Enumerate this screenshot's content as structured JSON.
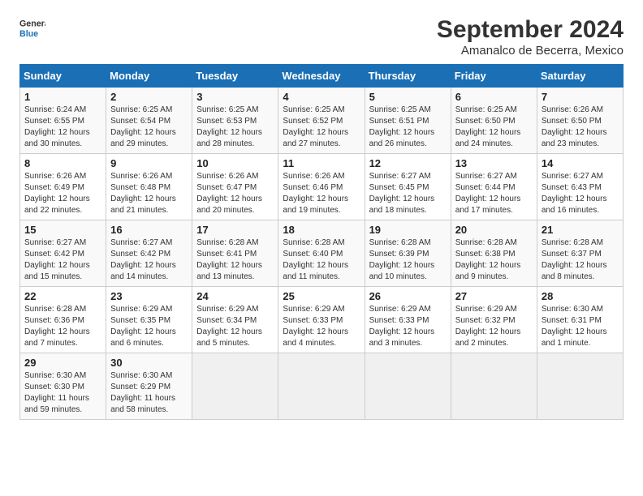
{
  "logo": {
    "line1": "General",
    "line2": "Blue"
  },
  "title": "September 2024",
  "subtitle": "Amanalco de Becerra, Mexico",
  "weekdays": [
    "Sunday",
    "Monday",
    "Tuesday",
    "Wednesday",
    "Thursday",
    "Friday",
    "Saturday"
  ],
  "weeks": [
    [
      {
        "day": "1",
        "content": "Sunrise: 6:24 AM\nSunset: 6:55 PM\nDaylight: 12 hours\nand 30 minutes."
      },
      {
        "day": "2",
        "content": "Sunrise: 6:25 AM\nSunset: 6:54 PM\nDaylight: 12 hours\nand 29 minutes."
      },
      {
        "day": "3",
        "content": "Sunrise: 6:25 AM\nSunset: 6:53 PM\nDaylight: 12 hours\nand 28 minutes."
      },
      {
        "day": "4",
        "content": "Sunrise: 6:25 AM\nSunset: 6:52 PM\nDaylight: 12 hours\nand 27 minutes."
      },
      {
        "day": "5",
        "content": "Sunrise: 6:25 AM\nSunset: 6:51 PM\nDaylight: 12 hours\nand 26 minutes."
      },
      {
        "day": "6",
        "content": "Sunrise: 6:25 AM\nSunset: 6:50 PM\nDaylight: 12 hours\nand 24 minutes."
      },
      {
        "day": "7",
        "content": "Sunrise: 6:26 AM\nSunset: 6:50 PM\nDaylight: 12 hours\nand 23 minutes."
      }
    ],
    [
      {
        "day": "8",
        "content": "Sunrise: 6:26 AM\nSunset: 6:49 PM\nDaylight: 12 hours\nand 22 minutes."
      },
      {
        "day": "9",
        "content": "Sunrise: 6:26 AM\nSunset: 6:48 PM\nDaylight: 12 hours\nand 21 minutes."
      },
      {
        "day": "10",
        "content": "Sunrise: 6:26 AM\nSunset: 6:47 PM\nDaylight: 12 hours\nand 20 minutes."
      },
      {
        "day": "11",
        "content": "Sunrise: 6:26 AM\nSunset: 6:46 PM\nDaylight: 12 hours\nand 19 minutes."
      },
      {
        "day": "12",
        "content": "Sunrise: 6:27 AM\nSunset: 6:45 PM\nDaylight: 12 hours\nand 18 minutes."
      },
      {
        "day": "13",
        "content": "Sunrise: 6:27 AM\nSunset: 6:44 PM\nDaylight: 12 hours\nand 17 minutes."
      },
      {
        "day": "14",
        "content": "Sunrise: 6:27 AM\nSunset: 6:43 PM\nDaylight: 12 hours\nand 16 minutes."
      }
    ],
    [
      {
        "day": "15",
        "content": "Sunrise: 6:27 AM\nSunset: 6:42 PM\nDaylight: 12 hours\nand 15 minutes."
      },
      {
        "day": "16",
        "content": "Sunrise: 6:27 AM\nSunset: 6:42 PM\nDaylight: 12 hours\nand 14 minutes."
      },
      {
        "day": "17",
        "content": "Sunrise: 6:28 AM\nSunset: 6:41 PM\nDaylight: 12 hours\nand 13 minutes."
      },
      {
        "day": "18",
        "content": "Sunrise: 6:28 AM\nSunset: 6:40 PM\nDaylight: 12 hours\nand 11 minutes."
      },
      {
        "day": "19",
        "content": "Sunrise: 6:28 AM\nSunset: 6:39 PM\nDaylight: 12 hours\nand 10 minutes."
      },
      {
        "day": "20",
        "content": "Sunrise: 6:28 AM\nSunset: 6:38 PM\nDaylight: 12 hours\nand 9 minutes."
      },
      {
        "day": "21",
        "content": "Sunrise: 6:28 AM\nSunset: 6:37 PM\nDaylight: 12 hours\nand 8 minutes."
      }
    ],
    [
      {
        "day": "22",
        "content": "Sunrise: 6:28 AM\nSunset: 6:36 PM\nDaylight: 12 hours\nand 7 minutes."
      },
      {
        "day": "23",
        "content": "Sunrise: 6:29 AM\nSunset: 6:35 PM\nDaylight: 12 hours\nand 6 minutes."
      },
      {
        "day": "24",
        "content": "Sunrise: 6:29 AM\nSunset: 6:34 PM\nDaylight: 12 hours\nand 5 minutes."
      },
      {
        "day": "25",
        "content": "Sunrise: 6:29 AM\nSunset: 6:33 PM\nDaylight: 12 hours\nand 4 minutes."
      },
      {
        "day": "26",
        "content": "Sunrise: 6:29 AM\nSunset: 6:33 PM\nDaylight: 12 hours\nand 3 minutes."
      },
      {
        "day": "27",
        "content": "Sunrise: 6:29 AM\nSunset: 6:32 PM\nDaylight: 12 hours\nand 2 minutes."
      },
      {
        "day": "28",
        "content": "Sunrise: 6:30 AM\nSunset: 6:31 PM\nDaylight: 12 hours\nand 1 minute."
      }
    ],
    [
      {
        "day": "29",
        "content": "Sunrise: 6:30 AM\nSunset: 6:30 PM\nDaylight: 11 hours\nand 59 minutes."
      },
      {
        "day": "30",
        "content": "Sunrise: 6:30 AM\nSunset: 6:29 PM\nDaylight: 11 hours\nand 58 minutes."
      },
      {
        "day": "",
        "content": ""
      },
      {
        "day": "",
        "content": ""
      },
      {
        "day": "",
        "content": ""
      },
      {
        "day": "",
        "content": ""
      },
      {
        "day": "",
        "content": ""
      }
    ]
  ]
}
